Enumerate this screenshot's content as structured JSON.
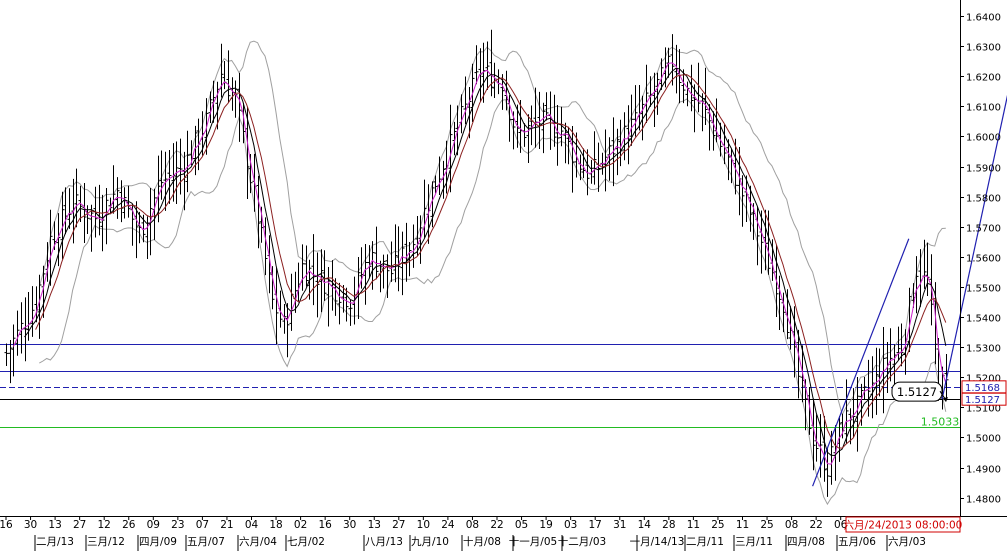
{
  "chart_data": {
    "type": "candlestick",
    "title": "",
    "xlabel": "",
    "ylabel": "",
    "ylim": [
      1.475,
      1.645
    ],
    "y_ticks": [
      1.48,
      1.49,
      1.5,
      1.51,
      1.52,
      1.53,
      1.54,
      1.55,
      1.56,
      1.57,
      1.58,
      1.59,
      1.6,
      1.61,
      1.62,
      1.63,
      1.64
    ],
    "y_tick_labels": [
      "1.4800",
      "1.4900",
      "1.5000",
      "1.5100",
      "1.5200",
      "1.5300",
      "1.5400",
      "1.5500",
      "1.5600",
      "1.5700",
      "1.5800",
      "1.5900",
      "1.6000",
      "1.6100",
      "1.6200",
      "1.6300",
      "1.6400"
    ],
    "day_labels": [
      "16",
      "30",
      "13",
      "27",
      "12",
      "26",
      "09",
      "23",
      "07",
      "21",
      "04",
      "18",
      "02",
      "16",
      "30",
      "13",
      "27",
      "10",
      "24",
      "08",
      "22",
      "05",
      "19",
      "03",
      "17",
      "31",
      "14",
      "28",
      "11",
      "25",
      "11",
      "25",
      "08",
      "22",
      "06"
    ],
    "month_labels": [
      "二月/13",
      "三月/12",
      "四月/09",
      "五月/07",
      "六月/04",
      "七月/02",
      "八月/13",
      "九月/10",
      "十月/08",
      "十一月/05",
      "十二月/03",
      "一月/14/13",
      "二月/11",
      "三月/11",
      "四月/08",
      "五月/06",
      "六月/03"
    ],
    "cursor_time_label": "六月/24/2013 08:00:00",
    "horizontal_lines": [
      {
        "value": 1.531,
        "color": "#2020b0",
        "style": "solid"
      },
      {
        "value": 1.522,
        "color": "#2020b0",
        "style": "solid"
      },
      {
        "value": 1.5168,
        "color": "#2020b0",
        "style": "dashed"
      },
      {
        "value": 1.5127,
        "color": "#000000",
        "style": "solid"
      },
      {
        "value": 1.5033,
        "color": "#22bb22",
        "style": "solid",
        "label": "1.5033"
      }
    ],
    "price_tags": [
      {
        "value": 1.5168,
        "text": "1.5168",
        "color": "#2020b0"
      },
      {
        "value": 1.5127,
        "text": "1.5127",
        "color": "#2020b0"
      }
    ],
    "callout": {
      "text": "1.5127",
      "value": 1.5127
    },
    "level_label": {
      "text": "1.5033",
      "value": 1.5033,
      "color": "#22bb22"
    },
    "trendlines": [
      {
        "from_bar": 218,
        "from_price": 1.4838,
        "to_bar": 244,
        "to_price": 1.566,
        "color": "#2020b0"
      },
      {
        "from_bar": 253,
        "from_price": 1.5127,
        "to_bar": 276,
        "to_price": 1.644,
        "color": "#2020b0"
      }
    ],
    "close_path": [
      [
        0,
        1.528
      ],
      [
        8,
        1.545
      ],
      [
        12,
        1.566
      ],
      [
        18,
        1.578
      ],
      [
        24,
        1.573
      ],
      [
        30,
        1.582
      ],
      [
        36,
        1.568
      ],
      [
        42,
        1.585
      ],
      [
        48,
        1.59
      ],
      [
        54,
        1.605
      ],
      [
        58,
        1.621
      ],
      [
        62,
        1.612
      ],
      [
        67,
        1.58
      ],
      [
        72,
        1.545
      ],
      [
        75,
        1.537
      ],
      [
        80,
        1.557
      ],
      [
        88,
        1.55
      ],
      [
        93,
        1.546
      ],
      [
        98,
        1.56
      ],
      [
        104,
        1.555
      ],
      [
        110,
        1.565
      ],
      [
        116,
        1.585
      ],
      [
        122,
        1.603
      ],
      [
        128,
        1.622
      ],
      [
        134,
        1.618
      ],
      [
        138,
        1.6
      ],
      [
        144,
        1.605
      ],
      [
        150,
        1.602
      ],
      [
        154,
        1.592
      ],
      [
        158,
        1.587
      ],
      [
        164,
        1.596
      ],
      [
        170,
        1.605
      ],
      [
        176,
        1.617
      ],
      [
        180,
        1.625
      ],
      [
        184,
        1.615
      ],
      [
        188,
        1.61
      ],
      [
        192,
        1.6
      ],
      [
        198,
        1.584
      ],
      [
        204,
        1.565
      ],
      [
        210,
        1.545
      ],
      [
        214,
        1.52
      ],
      [
        218,
        1.5
      ],
      [
        222,
        1.49
      ],
      [
        226,
        1.505
      ],
      [
        230,
        1.51
      ],
      [
        234,
        1.517
      ],
      [
        238,
        1.525
      ],
      [
        242,
        1.53
      ],
      [
        246,
        1.556
      ],
      [
        249,
        1.552
      ],
      [
        252,
        1.518
      ],
      [
        254,
        1.517
      ]
    ],
    "bar_count": 255,
    "moving_averages": [
      {
        "period": 3,
        "color": "#cc22cc"
      },
      {
        "period": 6,
        "color": "#000000"
      },
      {
        "period": 9,
        "color": "#8b2020"
      }
    ],
    "bollinger": {
      "period": 10,
      "deviations": 2,
      "color": "#a0a0a0"
    },
    "vertical_dashed_line_bar": 274
  }
}
